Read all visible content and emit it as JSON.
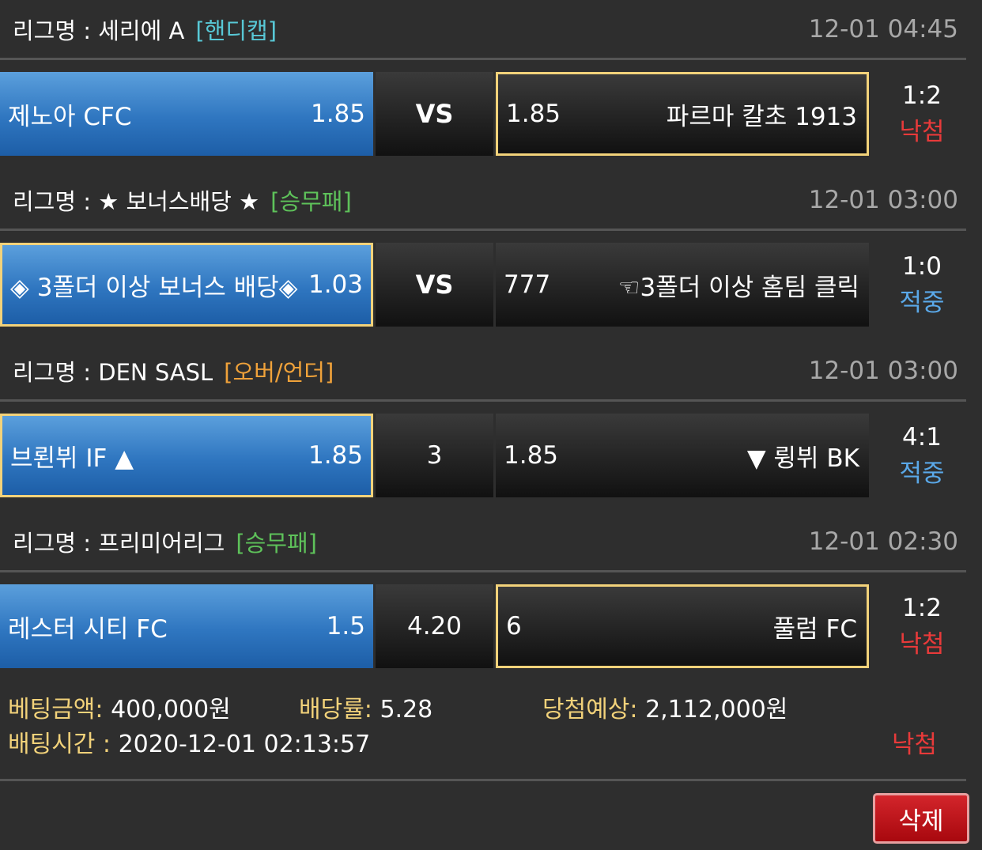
{
  "colors": {
    "tag_handicap": "#58c8d6",
    "tag_1x2": "#5ec25a",
    "tag_overunder": "#f0a23a",
    "result_miss": "#e83a3a",
    "result_hit": "#5aa8e8",
    "label_gold": "#f2d27a"
  },
  "matches": [
    {
      "league": "리그명 : 세리에 A",
      "tag": "[핸디캡]",
      "time": "12-01 04:45",
      "home_team": "제노아 CFC",
      "home_odds": "1.85",
      "mid": "VS",
      "away_odds": "1.85",
      "away_team": "파르마 칼초 1913",
      "score": "1:2",
      "result": "낙첨"
    },
    {
      "league": "리그명 : ★ 보너스배당 ★",
      "tag": "[승무패]",
      "time": "12-01 03:00",
      "home_team": "◈ 3폴더 이상 보너스 배당◈",
      "home_odds": "1.03",
      "mid": "VS",
      "away_odds": "777",
      "away_team": "☜3폴더 이상 홈팀 클릭",
      "score": "1:0",
      "result": "적중"
    },
    {
      "league": "리그명 : DEN SASL",
      "tag": "[오버/언더]",
      "time": "12-01 03:00",
      "home_team": "브뢴뷔 IF ▲",
      "home_odds": "1.85",
      "mid": "3",
      "away_odds": "1.85",
      "away_team": "▼ 륑뷔 BK",
      "score": "4:1",
      "result": "적중"
    },
    {
      "league": "리그명 : 프리미어리그",
      "tag": "[승무패]",
      "time": "12-01 02:30",
      "home_team": "레스터 시티 FC",
      "home_odds": "1.5",
      "mid": "4.20",
      "away_odds": "6",
      "away_team": "풀럼 FC",
      "score": "1:2",
      "result": "낙첨"
    }
  ],
  "summary": {
    "bet_amount_label": "베팅금액:",
    "bet_amount_value": "400,000원",
    "odds_label": "배당률:",
    "odds_value": "5.28",
    "expected_label": "당첨예상:",
    "expected_value": "2,112,000원",
    "bet_time_label": "배팅시간 :",
    "bet_time_value": "2020-12-01 02:13:57",
    "status": "낙첨"
  },
  "delete_label": "삭제"
}
